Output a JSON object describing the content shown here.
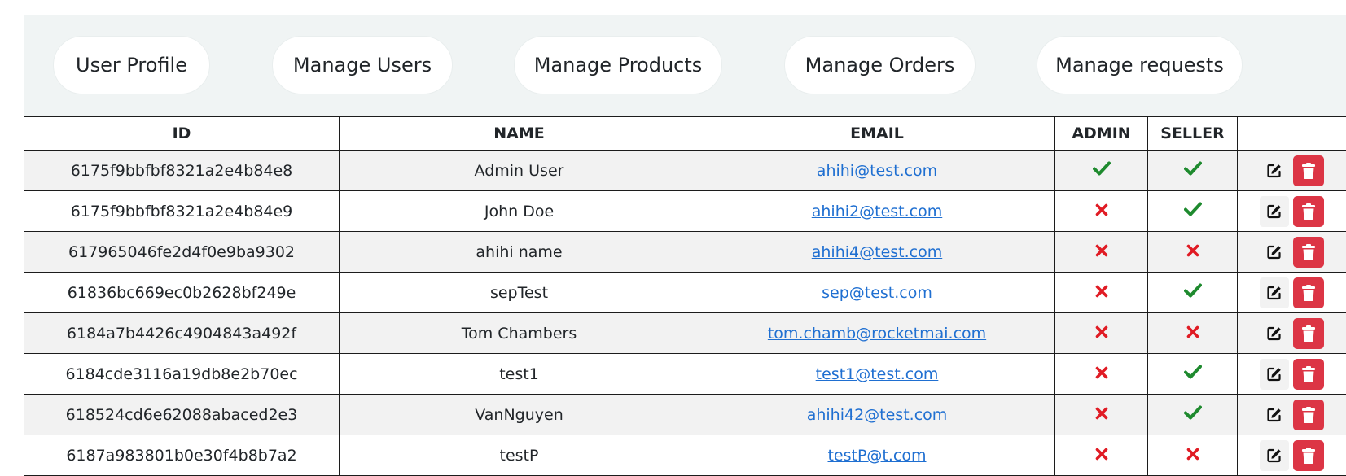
{
  "nav": {
    "tabs": [
      {
        "label": "User Profile"
      },
      {
        "label": "Manage Users"
      },
      {
        "label": "Manage Products"
      },
      {
        "label": "Manage Orders"
      },
      {
        "label": "Manage requests"
      }
    ]
  },
  "table": {
    "headers": {
      "id": "ID",
      "name": "NAME",
      "email": "EMAIL",
      "admin": "ADMIN",
      "seller": "SELLER",
      "actions": ""
    },
    "rows": [
      {
        "id": "6175f9bbfbf8321a2e4b84e8",
        "name": "Admin User",
        "email": "ahihi@test.com",
        "admin": true,
        "seller": true
      },
      {
        "id": "6175f9bbfbf8321a2e4b84e9",
        "name": "John Doe",
        "email": "ahihi2@test.com",
        "admin": false,
        "seller": true
      },
      {
        "id": "617965046fe2d4f0e9ba9302",
        "name": "ahihi name",
        "email": "ahihi4@test.com",
        "admin": false,
        "seller": false
      },
      {
        "id": "61836bc669ec0b2628bf249e",
        "name": "sepTest",
        "email": "sep@test.com",
        "admin": false,
        "seller": true
      },
      {
        "id": "6184a7b4426c4904843a492f",
        "name": "Tom Chambers",
        "email": "tom.chamb@rocketmai.com",
        "admin": false,
        "seller": false
      },
      {
        "id": "6184cde3116a19db8e2b70ec",
        "name": "test1",
        "email": "test1@test.com",
        "admin": false,
        "seller": true
      },
      {
        "id": "618524cd6e62088abaced2e3",
        "name": "VanNguyen",
        "email": "ahihi42@test.com",
        "admin": false,
        "seller": true
      },
      {
        "id": "6187a983801b0e30f4b8b7a2",
        "name": "testP",
        "email": "testP@t.com",
        "admin": false,
        "seller": false
      }
    ]
  },
  "colors": {
    "check": "#1e8a2e",
    "cross": "#e01b24",
    "delete": "#dc3545",
    "link": "#1f6fd1"
  },
  "icons": {
    "true": "check-icon",
    "false": "times-icon",
    "edit": "edit-icon",
    "delete": "trash-icon"
  }
}
